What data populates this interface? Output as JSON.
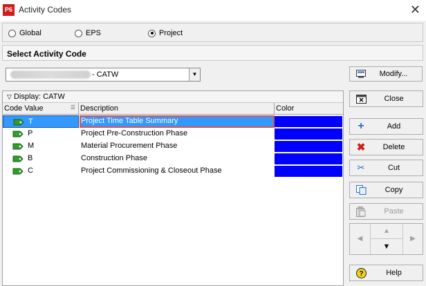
{
  "window": {
    "app_icon_text": "P6",
    "title": "Activity Codes",
    "close_glyph": "✕"
  },
  "scope": {
    "options": [
      "Global",
      "EPS",
      "Project"
    ],
    "selected": "Project"
  },
  "select_section": {
    "title": "Select Activity Code"
  },
  "activity_code": {
    "selected_value": "- CATW"
  },
  "buttons": {
    "modify": "Modify...",
    "close": "Close",
    "add": "Add",
    "delete": "Delete",
    "cut": "Cut",
    "copy": "Copy",
    "paste": "Paste",
    "help": "Help"
  },
  "grid": {
    "display_label": "Display: CATW",
    "columns": [
      "Code Value",
      "Description",
      "Color"
    ],
    "rows": [
      {
        "code": "T",
        "description": "Project Time Table Summary",
        "color": "#0000ff",
        "selected": true
      },
      {
        "code": "P",
        "description": "Project Pre-Construction Phase",
        "color": "#0000ff",
        "selected": false
      },
      {
        "code": "M",
        "description": "Material Procurement Phase",
        "color": "#0000ff",
        "selected": false
      },
      {
        "code": "B",
        "description": "Construction Phase",
        "color": "#0000ff",
        "selected": false
      },
      {
        "code": "C",
        "description": "Project Commissioning & Closeout Phase",
        "color": "#0000ff",
        "selected": false
      }
    ]
  },
  "colors": {
    "tag_green": "#2e9c2e",
    "selection": "#3399ff",
    "focus_outline": "#e2504a"
  }
}
